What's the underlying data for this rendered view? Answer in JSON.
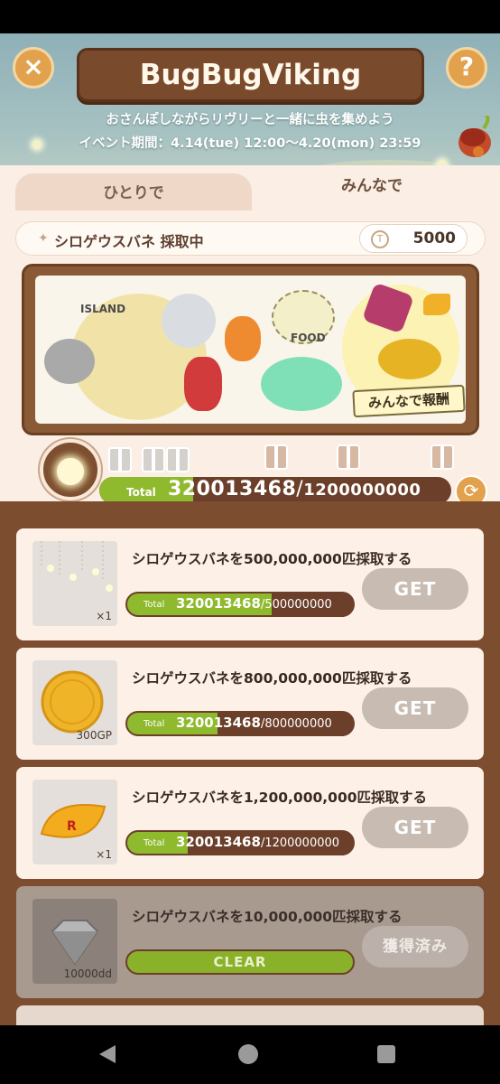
{
  "header": {
    "title": "BugBugViking",
    "subtitle": "おさんぽしながらリヴリーと一緒に虫を集めよう",
    "period": "イベント期間：4.14(tue) 12:00〜4.20(mon) 23:59",
    "close_icon": "×",
    "help_icon": "?"
  },
  "tabs": [
    {
      "label": "ひとりで",
      "active": false
    },
    {
      "label": "みんなで",
      "active": true
    }
  ],
  "status": {
    "text": "シロゲウスバネ 採取中",
    "currency_value": "5000"
  },
  "board": {
    "island_label": "ISLAND",
    "food_label": "FOOD",
    "reward_label": "みんなで報酬"
  },
  "progress": {
    "total_label": "Total",
    "current": "320013468",
    "separator": "/",
    "goal": "1200000000",
    "fraction": 0.267
  },
  "missions": [
    {
      "title": "シロゲウスバネを500,000,000匹採取する",
      "reward_qty": "×1",
      "total_label": "Total",
      "current": "320013468",
      "goal": "500000000",
      "fraction": 0.64,
      "button": "GET",
      "cleared": false
    },
    {
      "title": "シロゲウスバネを800,000,000匹採取する",
      "reward_qty": "300GP",
      "total_label": "Total",
      "current": "320013468",
      "goal": "800000000",
      "fraction": 0.4,
      "button": "GET",
      "cleared": false
    },
    {
      "title": "シロゲウスバネを1,200,000,000匹採取する",
      "reward_qty": "×1",
      "total_label": "Total",
      "current": "320013468",
      "goal": "1200000000",
      "fraction": 0.267,
      "button": "GET",
      "cleared": false
    },
    {
      "title": "シロゲウスバネを10,000,000匹採取する",
      "reward_qty": "10000dd",
      "clear_label": "CLEAR",
      "fraction": 1.0,
      "button": "獲得済み",
      "cleared": true
    }
  ],
  "colors": {
    "accent_orange": "#e2a14c",
    "progress_green": "#8fba2e",
    "wood_brown": "#7d4d30"
  }
}
